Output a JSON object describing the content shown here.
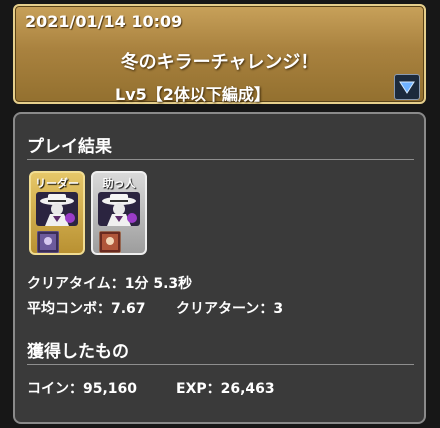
{
  "header": {
    "datetime": "2021/01/14 10:09",
    "title": "冬のキラーチャレンジ！",
    "subtitle": "Lv5【2体以下編成】"
  },
  "result": {
    "section_title": "プレイ結果",
    "leader_tag": "リーダー",
    "helper_tag": "助っ人",
    "clear_time_label": "クリアタイム",
    "clear_time_value": "1分 5.3秒",
    "avg_combo_label": "平均コンボ",
    "avg_combo_value": "7.67",
    "clear_turn_label": "クリアターン",
    "clear_turn_value": "3"
  },
  "rewards": {
    "section_title": "獲得したもの",
    "coin_label": "コイン",
    "coin_value": "95,160",
    "exp_label": "EXP",
    "exp_value": "26,463"
  },
  "colors": {
    "header_gold": "#a9823f",
    "panel_bg": "#3a3a3a",
    "leader_frame": "#d4b04c",
    "helper_frame": "#bdbdbd"
  },
  "icons": {
    "dropdown": "triangle-down-icon",
    "monster": "masked-villain-portrait"
  }
}
